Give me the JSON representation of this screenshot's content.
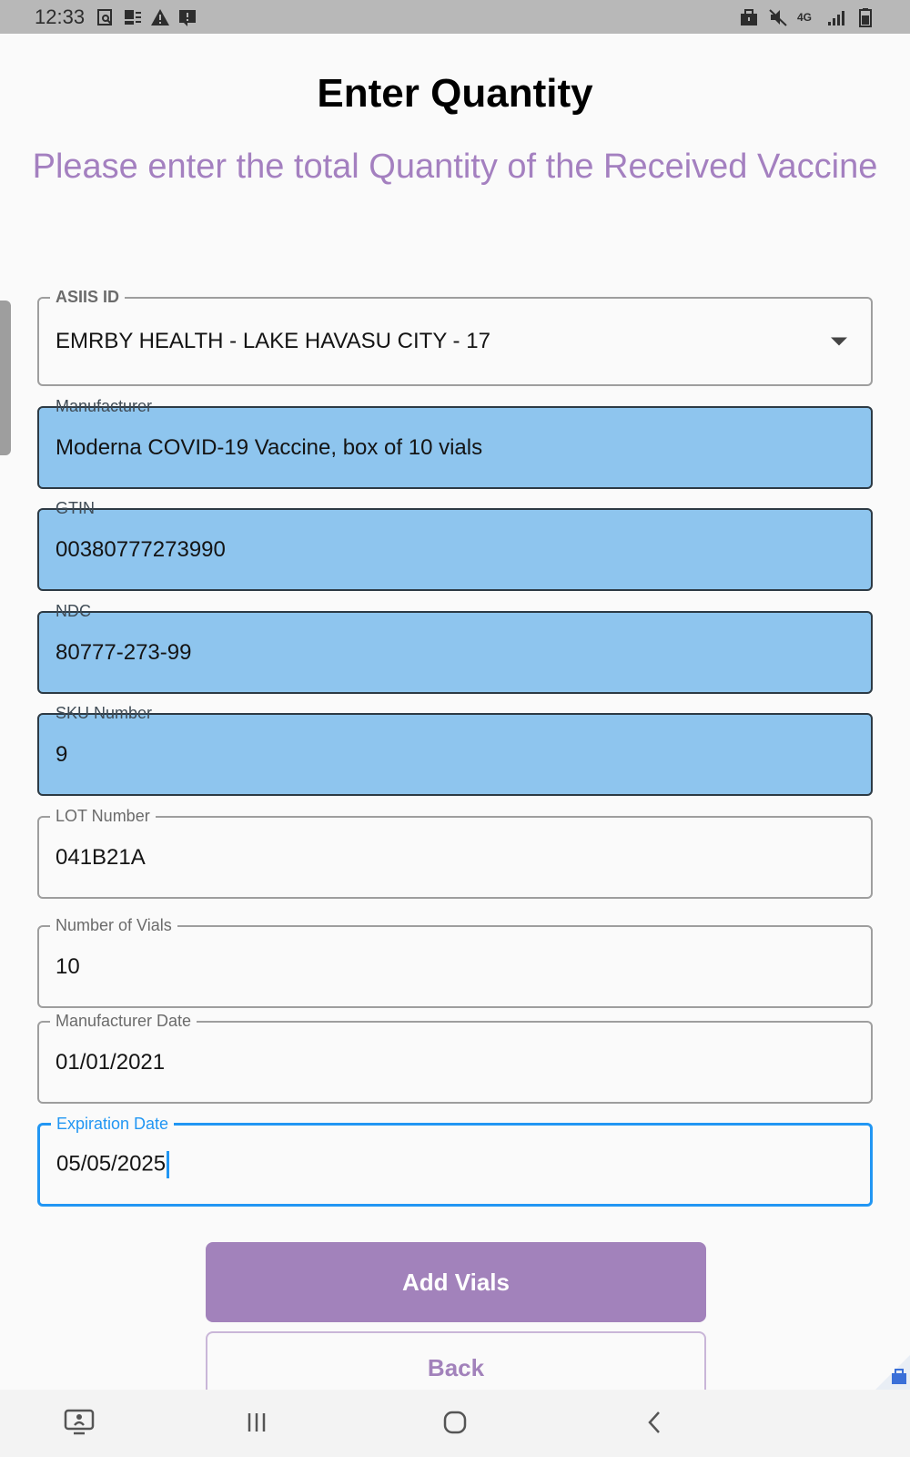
{
  "status_bar": {
    "time": "12:33",
    "left_icons": [
      "screenshot-icon",
      "contact-card-icon",
      "warning-icon",
      "alert-image-icon"
    ],
    "right_icons": [
      "briefcase-icon",
      "mute-icon",
      "4g-lte-icon",
      "signal-icon",
      "battery-icon"
    ],
    "network_label": "4G"
  },
  "header": {
    "title": "Enter Quantity",
    "subtitle": "Please enter the total Quantity of the Received Vaccine"
  },
  "form": {
    "asiis": {
      "label": "ASIIS ID",
      "value": "EMRBY HEALTH - LAKE HAVASU CITY - 17"
    },
    "manufacturer": {
      "label": "Manufacturer",
      "value": "Moderna COVID-19 Vaccine, box of 10 vials"
    },
    "gtin": {
      "label": "GTIN",
      "value": "00380777273990"
    },
    "ndc": {
      "label": "NDC",
      "value": "80777-273-99"
    },
    "sku": {
      "label": "SKU Number",
      "value": "9"
    },
    "lot": {
      "label": "LOT Number",
      "value": "041B21A"
    },
    "vials": {
      "label": "Number of Vials",
      "value": "10"
    },
    "mfg_date": {
      "label": "Manufacturer Date",
      "value": "01/01/2021"
    },
    "exp_date": {
      "label": "Expiration Date",
      "value": "05/05/2025"
    }
  },
  "buttons": {
    "add_vials": "Add Vials",
    "back": "Back"
  },
  "nav_bar": {
    "icons": [
      "screen-share-icon",
      "recent-apps-icon",
      "home-icon",
      "back-arrow-icon"
    ]
  },
  "colors": {
    "accent": "#a282bb",
    "filled_field": "#8ec5ee",
    "focus": "#2196f3",
    "status_bar": "#b8b8b8"
  }
}
